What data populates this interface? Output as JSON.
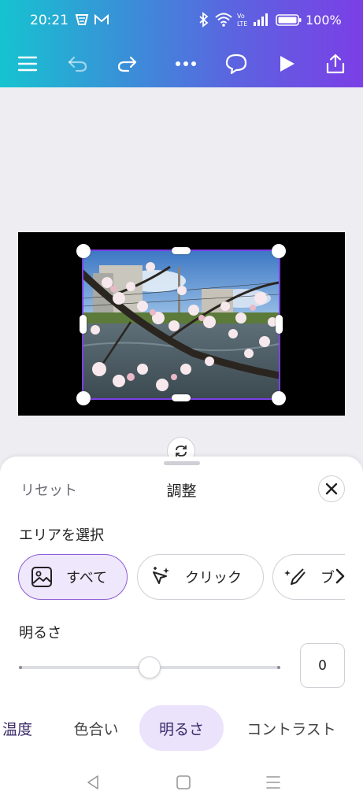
{
  "status": {
    "time": "20:21",
    "battery_percent": "100%",
    "icons": [
      "fan-notification-icon",
      "mail-icon",
      "bluetooth-icon",
      "wifi-icon",
      "volte-icon",
      "signal-icon",
      "battery-icon"
    ]
  },
  "toolbar": {
    "icons": [
      "menu-icon",
      "undo-icon",
      "redo-icon",
      "more-icon",
      "comment-icon",
      "play-icon",
      "share-icon"
    ]
  },
  "sheet": {
    "reset_label": "リセット",
    "title": "調整",
    "area_label": "エリアを選択",
    "chips": [
      {
        "label": "すべて",
        "icon": "image-icon",
        "active": true
      },
      {
        "label": "クリック",
        "icon": "sparkle-cursor-icon",
        "active": false
      },
      {
        "label": "ブ",
        "icon": "brush-icon",
        "active": false
      }
    ],
    "brightness_label": "明るさ",
    "brightness_value": "0",
    "slider_fraction": 0.5,
    "tabs": [
      {
        "label": "温度",
        "active": false
      },
      {
        "label": "色合い",
        "active": false
      },
      {
        "label": "明るさ",
        "active": true
      },
      {
        "label": "コントラスト",
        "active": false
      }
    ]
  },
  "colors": {
    "accent": "#7b3fe6",
    "chip_active_bg": "#efe7fb",
    "tab_active_bg": "#ebe2fb"
  },
  "navbar": {
    "icons": [
      "back-icon",
      "home-icon",
      "recents-icon"
    ]
  }
}
